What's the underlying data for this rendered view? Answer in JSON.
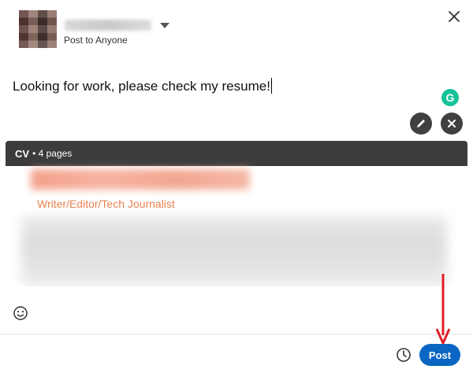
{
  "header": {
    "audience_label": "Post to Anyone",
    "close_icon": "close-icon"
  },
  "composer": {
    "text": "Looking for work, please check my resume!",
    "grammarly_glyph": "G"
  },
  "attachment": {
    "title": "CV",
    "meta": "• 4 pages",
    "preview_role": "Writer/Editor/Tech Journalist"
  },
  "footer": {
    "post_label": "Post"
  },
  "colors": {
    "accent": "#0a66c2",
    "annotation_arrow": "#e01f26",
    "grammarly": "#15c39a"
  }
}
